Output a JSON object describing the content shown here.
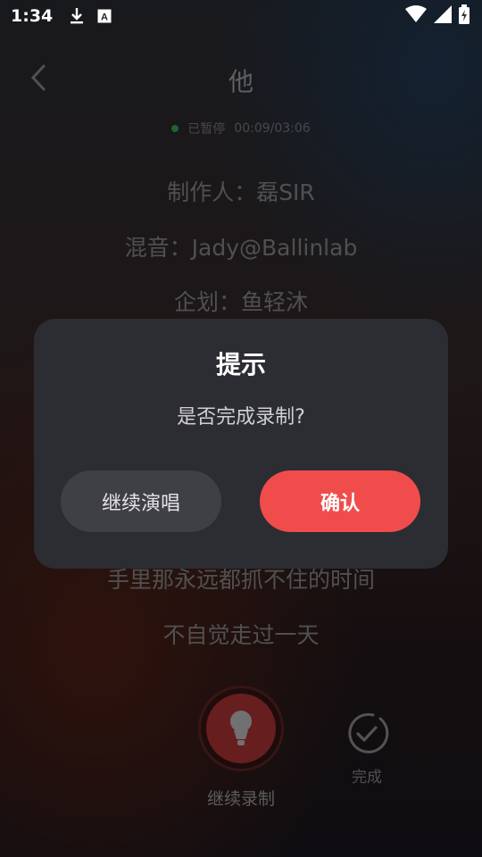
{
  "status_bar": {
    "time": "1:34",
    "icons": [
      "download-icon",
      "a-icon",
      "wifi-icon",
      "signal-icon",
      "battery-icon"
    ]
  },
  "header": {
    "title": "他",
    "status_text": "已暂停",
    "progress_time": "00:09/03:06"
  },
  "lyrics": [
    "制作人：磊SIR",
    "混音：Jady@Ballinlab",
    "企划：鱼轻沐",
    "手里那永远都抓不住的时间",
    "不自觉走过一天"
  ],
  "controls": {
    "record_label": "继续录制",
    "done_label": "完成"
  },
  "dialog": {
    "title": "提示",
    "message": "是否完成录制?",
    "continue_label": "继续演唱",
    "confirm_label": "确认"
  },
  "colors": {
    "accent": "#f04c4c",
    "status_dot": "#3fbf5a"
  }
}
